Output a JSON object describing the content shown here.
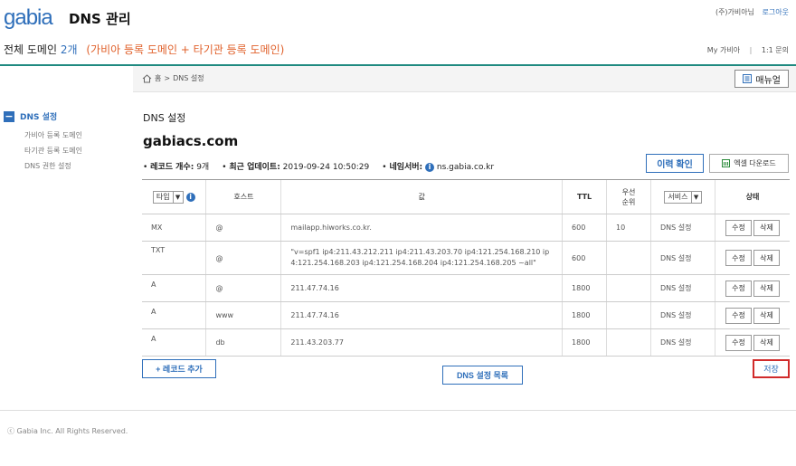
{
  "header": {
    "logo_text": "gabia",
    "title": "DNS 관리",
    "user": "(주)가비아님",
    "logout": "로그아웃",
    "my_gabia": "My 가비아",
    "separator": "|",
    "inquiry": "1:1 문의",
    "domains_label": "전체 도메인",
    "domains_count": "2개",
    "domains_note": "(가비아 등록 도메인 + 타기관 등록 도메인)"
  },
  "breadcrumb": {
    "home": "홈",
    "sep": ">",
    "current": "DNS 설정"
  },
  "manual_button": "매뉴얼",
  "nav": {
    "head": "DNS 설정",
    "items": [
      "가비아 등록 도메인",
      "타기관 등록 도메인",
      "DNS 권한 설정"
    ]
  },
  "content": {
    "page_title": "DNS 설정",
    "domain": "gabiacs.com",
    "record_count_label": "레코드 개수:",
    "record_count": "9개",
    "updated_label": "최근 업데이트:",
    "updated": "2019-09-24 10:50:29",
    "nameserver_label": "네임서버:",
    "nameserver": "ns.gabia.co.kr",
    "history_button": "이력 확인",
    "excel_button": "엑셀 다운로드"
  },
  "table": {
    "type_filter": "타입",
    "headers": {
      "host": "호스트",
      "value": "값",
      "ttl": "TTL",
      "priority_1": "우선",
      "priority_2": "순위",
      "service": "서비스",
      "status": "상태"
    },
    "edit_label": "수정",
    "delete_label": "삭제",
    "rows": [
      {
        "type": "MX",
        "host": "@",
        "value": "mailapp.hiworks.co.kr.",
        "ttl": "600",
        "priority": "10",
        "service": "DNS 설정"
      },
      {
        "type": "TXT",
        "host": "@",
        "value": "\"v=spf1 ip4:211.43.212.211 ip4:211.43.203.70 ip4:121.254.168.210 ip4:121.254.168.203 ip4:121.254.168.204 ip4:121.254.168.205 ~all\"",
        "ttl": "600",
        "priority": "",
        "service": "DNS 설정"
      },
      {
        "type": "A",
        "host": "@",
        "value": "211.47.74.16",
        "ttl": "1800",
        "priority": "",
        "service": "DNS 설정"
      },
      {
        "type": "A",
        "host": "www",
        "value": "211.47.74.16",
        "ttl": "1800",
        "priority": "",
        "service": "DNS 설정"
      },
      {
        "type": "A",
        "host": "db",
        "value": "211.43.203.77",
        "ttl": "1800",
        "priority": "",
        "service": "DNS 설정"
      }
    ]
  },
  "buttons": {
    "add_record": "+ 레코드 추가",
    "dns_list": "DNS 설정 목록",
    "save": "저장"
  },
  "footer": "ⓒ Gabia Inc. All Rights Reserved.",
  "colors": {
    "brand_blue": "#2f6fba",
    "accent_orange": "#e0602a",
    "teal_rule": "#1f8a80",
    "save_border": "#d12b2b"
  }
}
